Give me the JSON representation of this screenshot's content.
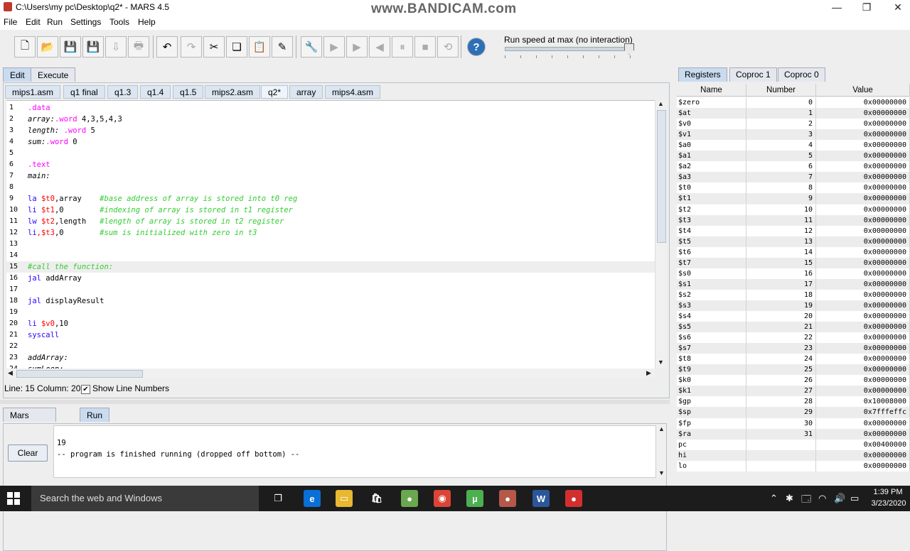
{
  "window": {
    "title": "C:\\Users\\my pc\\Desktop\\q2* - MARS 4.5",
    "watermark": "www.BANDICAM.com",
    "controls": [
      "—",
      "❐",
      "✕"
    ]
  },
  "menu": [
    {
      "label": "File"
    },
    {
      "label": "Edit"
    },
    {
      "label": "Run"
    },
    {
      "label": "Settings"
    },
    {
      "label": "Tools"
    },
    {
      "label": "Help"
    }
  ],
  "toolbar": {
    "buttons": [
      {
        "name": "new-file-icon",
        "glyph": "🗋"
      },
      {
        "name": "open-file-icon",
        "glyph": "📂"
      },
      {
        "name": "save-file-icon",
        "glyph": "💾"
      },
      {
        "name": "save-as-icon",
        "glyph": "💾"
      },
      {
        "name": "dump-memory-icon",
        "glyph": "⇩"
      },
      {
        "name": "print-icon",
        "glyph": "🖶"
      },
      {
        "name": "undo-icon",
        "glyph": "↶"
      },
      {
        "name": "redo-icon",
        "glyph": "↷"
      },
      {
        "name": "cut-icon",
        "glyph": "✂"
      },
      {
        "name": "copy-icon",
        "glyph": "❏"
      },
      {
        "name": "paste-icon",
        "glyph": "📋"
      },
      {
        "name": "find-replace-icon",
        "glyph": "✎"
      },
      {
        "name": "assemble-icon",
        "glyph": "🔧"
      },
      {
        "name": "run-icon",
        "glyph": "▶"
      },
      {
        "name": "step-icon",
        "glyph": "▶"
      },
      {
        "name": "backstep-icon",
        "glyph": "◀"
      },
      {
        "name": "pause-icon",
        "glyph": "⏸"
      },
      {
        "name": "stop-icon",
        "glyph": "■"
      },
      {
        "name": "reset-icon",
        "glyph": "⟲"
      },
      {
        "name": "help-icon",
        "glyph": "?"
      }
    ],
    "speed_label": "Run speed at max (no interaction)",
    "speed_fraction": 1.0
  },
  "main_tabs": [
    {
      "label": "Edit",
      "active": true
    },
    {
      "label": "Execute",
      "active": false
    }
  ],
  "file_tabs": [
    {
      "label": "mips1.asm"
    },
    {
      "label": "q1 final"
    },
    {
      "label": "q1.3"
    },
    {
      "label": "q1.4"
    },
    {
      "label": "q1.5"
    },
    {
      "label": "mips2.asm"
    },
    {
      "label": "q2*",
      "active": true
    },
    {
      "label": "array"
    },
    {
      "label": "mips4.asm"
    }
  ],
  "code_lines": [
    {
      "n": "1",
      "segs": [
        {
          "t": ".data",
          "c": "dir"
        }
      ]
    },
    {
      "n": "2",
      "segs": [
        {
          "t": "array:",
          "c": "lbl"
        },
        {
          "t": ".word",
          "c": "dir"
        },
        {
          "t": " 4,3,5,4,3",
          "c": "plain"
        }
      ]
    },
    {
      "n": "3",
      "segs": [
        {
          "t": "length:",
          "c": "lbl"
        },
        {
          "t": " .word",
          "c": "dir"
        },
        {
          "t": " 5",
          "c": "plain"
        }
      ]
    },
    {
      "n": "4",
      "segs": [
        {
          "t": "sum:",
          "c": "lbl"
        },
        {
          "t": ".word",
          "c": "dir"
        },
        {
          "t": " 0",
          "c": "plain"
        }
      ]
    },
    {
      "n": "5",
      "segs": []
    },
    {
      "n": "6",
      "segs": [
        {
          "t": ".text",
          "c": "dir"
        }
      ]
    },
    {
      "n": "7",
      "segs": [
        {
          "t": "main:",
          "c": "lbl"
        }
      ]
    },
    {
      "n": "8",
      "segs": []
    },
    {
      "n": "9",
      "segs": [
        {
          "t": "la",
          "c": "ins"
        },
        {
          "t": " $t0",
          "c": "reg"
        },
        {
          "t": ",array    ",
          "c": "plain"
        },
        {
          "t": "#base address of array is stored into t0 reg",
          "c": "cmt"
        }
      ]
    },
    {
      "n": "10",
      "segs": [
        {
          "t": "li",
          "c": "ins"
        },
        {
          "t": " $t1",
          "c": "reg"
        },
        {
          "t": ",0        ",
          "c": "plain"
        },
        {
          "t": "#indexing of array is stored in t1 register",
          "c": "cmt"
        }
      ]
    },
    {
      "n": "11",
      "segs": [
        {
          "t": "lw",
          "c": "ins"
        },
        {
          "t": " $t2",
          "c": "reg"
        },
        {
          "t": ",length   ",
          "c": "plain"
        },
        {
          "t": "#length of array is stored in t2 register",
          "c": "cmt"
        }
      ]
    },
    {
      "n": "12",
      "segs": [
        {
          "t": "li",
          "c": "ins"
        },
        {
          "t": ",$t3",
          "c": "reg"
        },
        {
          "t": ",0        ",
          "c": "plain"
        },
        {
          "t": "#sum is initialized with zero in t3",
          "c": "cmt"
        }
      ]
    },
    {
      "n": "13",
      "segs": []
    },
    {
      "n": "14",
      "segs": []
    },
    {
      "n": "15",
      "segs": [
        {
          "t": "#call the function:",
          "c": "cmt"
        }
      ],
      "hl": true
    },
    {
      "n": "16",
      "segs": [
        {
          "t": "jal",
          "c": "ins"
        },
        {
          "t": " addArray",
          "c": "plain"
        }
      ]
    },
    {
      "n": "17",
      "segs": []
    },
    {
      "n": "18",
      "segs": [
        {
          "t": "jal",
          "c": "ins"
        },
        {
          "t": " displayResult",
          "c": "plain"
        }
      ]
    },
    {
      "n": "19",
      "segs": []
    },
    {
      "n": "20",
      "segs": [
        {
          "t": "li",
          "c": "ins"
        },
        {
          "t": " $v0",
          "c": "reg"
        },
        {
          "t": ",10",
          "c": "plain"
        }
      ]
    },
    {
      "n": "21",
      "segs": [
        {
          "t": "syscall",
          "c": "ins"
        }
      ]
    },
    {
      "n": "22",
      "segs": []
    },
    {
      "n": "23",
      "segs": [
        {
          "t": "addArray:",
          "c": "lbl"
        }
      ]
    },
    {
      "n": "24",
      "segs": [
        {
          "t": "sumLoop:",
          "c": "lbl"
        }
      ]
    }
  ],
  "status": {
    "position": "Line: 15 Column: 20",
    "show_line_numbers": "Show Line Numbers",
    "checkmark": "✔"
  },
  "message_tabs": [
    {
      "label": "Mars Messages",
      "active": false
    },
    {
      "label": "Run I/O",
      "active": true
    }
  ],
  "clear_button": "Clear",
  "output_lines": [
    "",
    "19",
    "-- program is finished running (dropped off bottom) --"
  ],
  "register_tabs": [
    {
      "label": "Registers",
      "active": true
    },
    {
      "label": "Coproc 1",
      "active": false
    },
    {
      "label": "Coproc 0",
      "active": false
    }
  ],
  "register_headers": {
    "name": "Name",
    "number": "Number",
    "value": "Value"
  },
  "registers": [
    {
      "name": "$zero",
      "num": "0",
      "val": "0x00000000"
    },
    {
      "name": "$at",
      "num": "1",
      "val": "0x00000000"
    },
    {
      "name": "$v0",
      "num": "2",
      "val": "0x00000000"
    },
    {
      "name": "$v1",
      "num": "3",
      "val": "0x00000000"
    },
    {
      "name": "$a0",
      "num": "4",
      "val": "0x00000000"
    },
    {
      "name": "$a1",
      "num": "5",
      "val": "0x00000000"
    },
    {
      "name": "$a2",
      "num": "6",
      "val": "0x00000000"
    },
    {
      "name": "$a3",
      "num": "7",
      "val": "0x00000000"
    },
    {
      "name": "$t0",
      "num": "8",
      "val": "0x00000000"
    },
    {
      "name": "$t1",
      "num": "9",
      "val": "0x00000000"
    },
    {
      "name": "$t2",
      "num": "10",
      "val": "0x00000000"
    },
    {
      "name": "$t3",
      "num": "11",
      "val": "0x00000000"
    },
    {
      "name": "$t4",
      "num": "12",
      "val": "0x00000000"
    },
    {
      "name": "$t5",
      "num": "13",
      "val": "0x00000000"
    },
    {
      "name": "$t6",
      "num": "14",
      "val": "0x00000000"
    },
    {
      "name": "$t7",
      "num": "15",
      "val": "0x00000000"
    },
    {
      "name": "$s0",
      "num": "16",
      "val": "0x00000000"
    },
    {
      "name": "$s1",
      "num": "17",
      "val": "0x00000000"
    },
    {
      "name": "$s2",
      "num": "18",
      "val": "0x00000000"
    },
    {
      "name": "$s3",
      "num": "19",
      "val": "0x00000000"
    },
    {
      "name": "$s4",
      "num": "20",
      "val": "0x00000000"
    },
    {
      "name": "$s5",
      "num": "21",
      "val": "0x00000000"
    },
    {
      "name": "$s6",
      "num": "22",
      "val": "0x00000000"
    },
    {
      "name": "$s7",
      "num": "23",
      "val": "0x00000000"
    },
    {
      "name": "$t8",
      "num": "24",
      "val": "0x00000000"
    },
    {
      "name": "$t9",
      "num": "25",
      "val": "0x00000000"
    },
    {
      "name": "$k0",
      "num": "26",
      "val": "0x00000000"
    },
    {
      "name": "$k1",
      "num": "27",
      "val": "0x00000000"
    },
    {
      "name": "$gp",
      "num": "28",
      "val": "0x10008000"
    },
    {
      "name": "$sp",
      "num": "29",
      "val": "0x7fffeffc"
    },
    {
      "name": "$fp",
      "num": "30",
      "val": "0x00000000"
    },
    {
      "name": "$ra",
      "num": "31",
      "val": "0x00000000"
    },
    {
      "name": "pc",
      "num": "",
      "val": "0x00400000"
    },
    {
      "name": "hi",
      "num": "",
      "val": "0x00000000"
    },
    {
      "name": "lo",
      "num": "",
      "val": "0x00000000"
    }
  ],
  "taskbar": {
    "search_placeholder": "Search the web and Windows",
    "apps": [
      {
        "name": "task-view-icon",
        "glyph": "❐",
        "color": "#1c1c1c"
      },
      {
        "name": "edge-icon",
        "glyph": "e",
        "color": "#0a6fd6"
      },
      {
        "name": "file-explorer-icon",
        "glyph": "▭",
        "color": "#e8b830"
      },
      {
        "name": "store-icon",
        "glyph": "🛍",
        "color": "#1c1c1c"
      },
      {
        "name": "android-icon",
        "glyph": "●",
        "color": "#6aa84f"
      },
      {
        "name": "chrome-icon",
        "glyph": "◉",
        "color": "#db4437"
      },
      {
        "name": "utorrent-icon",
        "glyph": "µ",
        "color": "#4caf50"
      },
      {
        "name": "mars-icon",
        "glyph": "●",
        "color": "#b5584a"
      },
      {
        "name": "word-icon",
        "glyph": "W",
        "color": "#2b579a"
      },
      {
        "name": "record-icon",
        "glyph": "●",
        "color": "#d32f2f"
      }
    ],
    "tray": [
      "⌃",
      "✱",
      "🗔",
      "◠",
      "🔊",
      "▭"
    ],
    "time": "1:39 PM",
    "date": "3/23/2020"
  }
}
